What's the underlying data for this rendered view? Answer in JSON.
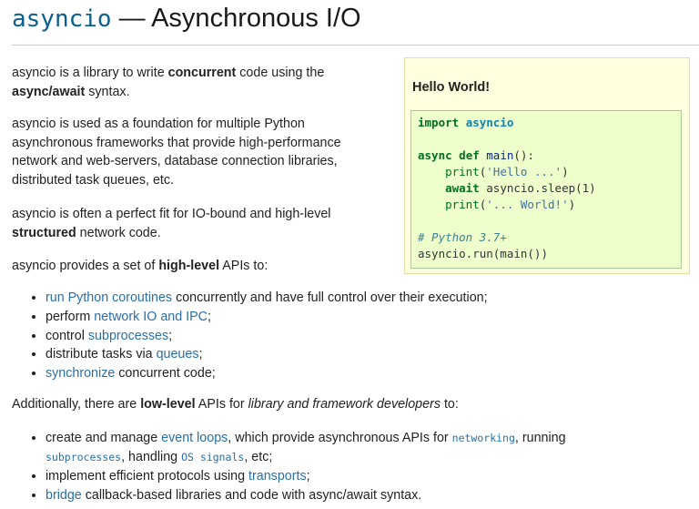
{
  "title": {
    "module": "asyncio",
    "rest": " — Asynchronous I/O"
  },
  "intro": {
    "p1": {
      "a": "asyncio is a library to write ",
      "b": "concurrent",
      "c": " code using the",
      "d": "async/await",
      "e": " syntax."
    },
    "p2": {
      "l1": "asyncio is used as a foundation for multiple Python",
      "l2": "asynchronous frameworks that provide high-performance",
      "l3": "network and web-servers, database connection libraries,",
      "l4": "distributed task queues, etc."
    },
    "p3": {
      "l1": "asyncio is often a perfect fit for IO-bound and high-level",
      "b": "structured",
      "l2": " network code."
    },
    "p4": {
      "a": "asyncio provides a set of ",
      "b": "high-level",
      "c": " APIs to:"
    }
  },
  "sidebar": {
    "title": "Hello World!",
    "code": {
      "import": "import",
      "mod": "asyncio",
      "async": "async",
      "def": "def",
      "fn": "main",
      "fn_tail": "():",
      "print": "print",
      "s1": "'Hello ...'",
      "await": "await",
      "sleep_call": "asyncio.sleep(1)",
      "s2": "'... World!'",
      "comment": "# Python 3.7+",
      "run_line": "asyncio.run(main())"
    }
  },
  "high_level": [
    {
      "link": "run Python coroutines",
      "text": " concurrently and have full control over their execution;"
    },
    {
      "pre": "perform ",
      "link": "network IO and IPC",
      "post": ";"
    },
    {
      "pre": "control ",
      "link": "subprocesses",
      "post": ";"
    },
    {
      "pre": "distribute tasks via ",
      "link": "queues",
      "post": ";"
    },
    {
      "link": "synchronize",
      "text": " concurrent code;"
    }
  ],
  "low_intro": {
    "a": "Additionally, there are ",
    "b": "low-level",
    "c": " APIs for ",
    "d": "library and framework developers",
    "e": " to:"
  },
  "low_level": {
    "item1": {
      "pre": "create and manage ",
      "link": "event loops",
      "mid": ", which provide asynchronous APIs for ",
      "code1": "networking",
      "after1": ", running",
      "code2": "subprocesses",
      "after2": ", handling ",
      "code3": "OS signals",
      "after3": ", etc;"
    },
    "item2": {
      "pre": "implement efficient protocols using ",
      "link": "transports",
      "post": ";"
    },
    "item3": {
      "link": "bridge",
      "text": " callback-based libraries and code with async/await syntax."
    }
  }
}
